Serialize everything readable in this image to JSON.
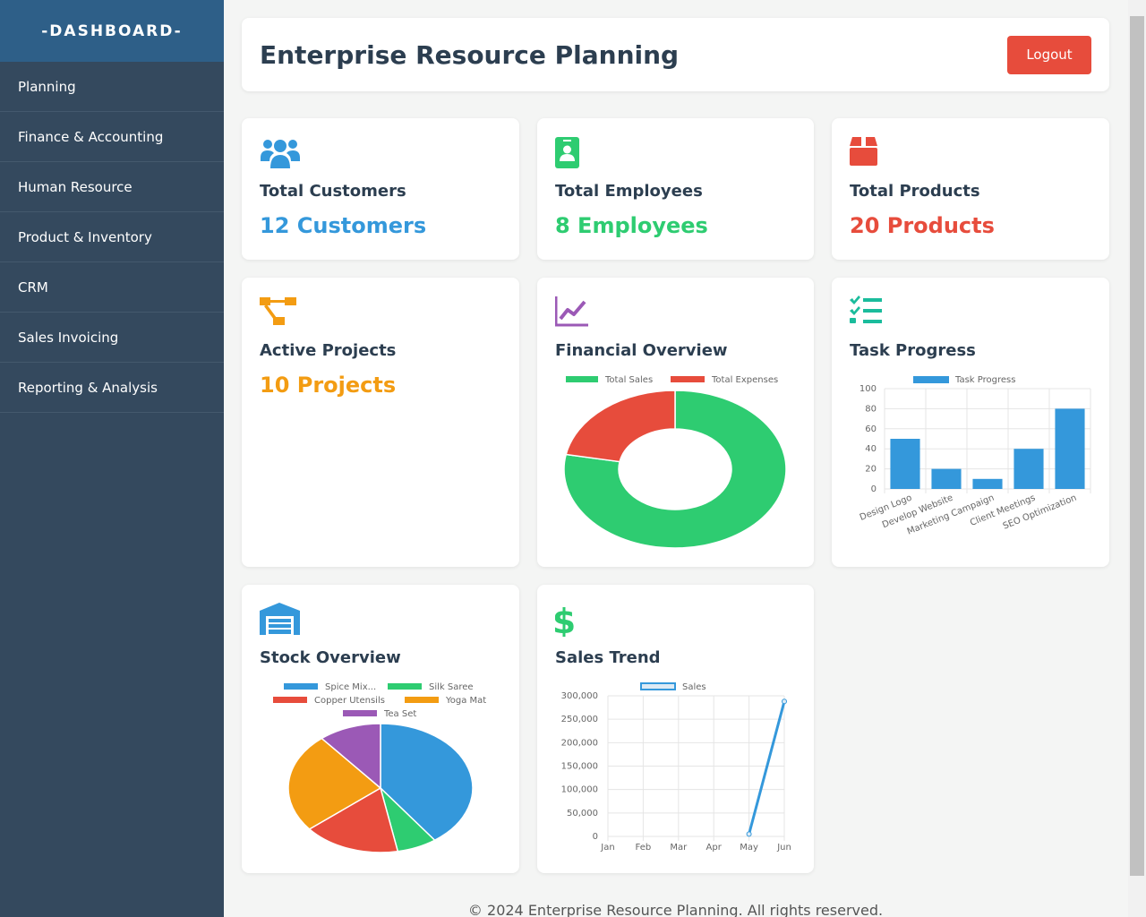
{
  "sidebar": {
    "title": "-DASHBOARD-",
    "items": [
      {
        "label": "Planning"
      },
      {
        "label": "Finance & Accounting"
      },
      {
        "label": "Human Resource"
      },
      {
        "label": "Product & Inventory"
      },
      {
        "label": "CRM"
      },
      {
        "label": "Sales Invoicing"
      },
      {
        "label": "Reporting & Analysis"
      }
    ]
  },
  "header": {
    "title": "Enterprise Resource Planning",
    "logout_label": "Logout"
  },
  "cards": {
    "customers": {
      "title": "Total Customers",
      "value": "12 Customers",
      "color": "#3498db",
      "icon": "users-icon"
    },
    "employees": {
      "title": "Total Employees",
      "value": "8 Employees",
      "color": "#2ecc71",
      "icon": "id-badge-icon"
    },
    "products": {
      "title": "Total Products",
      "value": "20 Products",
      "color": "#e74c3c",
      "icon": "box-icon"
    },
    "projects": {
      "title": "Active Projects",
      "value": "10 Projects",
      "color": "#f39c12",
      "icon": "project-diagram-icon"
    },
    "financial": {
      "title": "Financial Overview",
      "icon": "chart-line-icon"
    },
    "tasks": {
      "title": "Task Progress",
      "icon": "tasks-icon"
    },
    "stock": {
      "title": "Stock Overview",
      "icon": "warehouse-icon"
    },
    "sales": {
      "title": "Sales Trend",
      "icon": "dollar-icon"
    }
  },
  "chart_data": [
    {
      "type": "pie",
      "variant": "doughnut",
      "legend_position": "top",
      "labels": [
        "Total Sales",
        "Total Expenses"
      ],
      "values": [
        78,
        22
      ],
      "colors": [
        "#2ecc71",
        "#e74c3c"
      ]
    },
    {
      "type": "bar",
      "legend_position": "top",
      "series": [
        {
          "name": "Task Progress",
          "values": [
            50,
            20,
            10,
            40,
            80
          ]
        }
      ],
      "categories": [
        "Design Logo",
        "Develop Website",
        "Marketing Campaign",
        "Client Meetings",
        "SEO Optimization"
      ],
      "ylim": [
        0,
        100
      ],
      "yticks": [
        "0",
        "20",
        "40",
        "60",
        "80",
        "100"
      ],
      "color": "#3498db",
      "grid": true
    },
    {
      "type": "pie",
      "legend_position": "top",
      "labels": [
        "Spice Mix...",
        "Silk Saree",
        "Copper Utensils",
        "Yoga Mat",
        "Tea Set"
      ],
      "values": [
        40,
        7,
        17,
        25,
        11
      ],
      "colors": [
        "#3498db",
        "#2ecc71",
        "#e74c3c",
        "#f39c12",
        "#9b59b6"
      ]
    },
    {
      "type": "line",
      "legend_position": "top",
      "series": [
        {
          "name": "Sales",
          "values": [
            null,
            null,
            null,
            null,
            5000,
            288000
          ]
        }
      ],
      "categories": [
        "Jan",
        "Feb",
        "Mar",
        "Apr",
        "May",
        "Jun"
      ],
      "ylim": [
        0,
        300000
      ],
      "yticks": [
        "0",
        "50,000",
        "100,000",
        "150,000",
        "200,000",
        "250,000",
        "300,000"
      ],
      "color": "#3498db",
      "grid": true
    }
  ],
  "footer": {
    "text": "© 2024 Enterprise Resource Planning. All rights reserved."
  }
}
